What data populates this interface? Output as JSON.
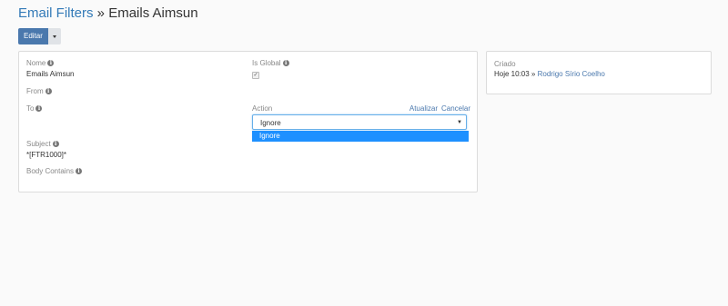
{
  "header": {
    "breadcrumb_link": "Email Filters",
    "separator": " » ",
    "current": "Emails Aimsun"
  },
  "toolbar": {
    "edit_label": "Editar"
  },
  "form": {
    "name": {
      "label": "Nome",
      "value": "Emails Aimsun"
    },
    "is_global": {
      "label": "Is Global",
      "checked": true
    },
    "from": {
      "label": "From"
    },
    "to": {
      "label": "To"
    },
    "action": {
      "label": "Action",
      "update_label": "Atualizar",
      "cancel_label": "Cancelar",
      "selected": "Ignore",
      "options": [
        "Ignore"
      ]
    },
    "subject": {
      "label": "Subject",
      "value": "*[FTR1000]*"
    },
    "body_contains": {
      "label": "Body Contains"
    }
  },
  "side": {
    "created_label": "Criado",
    "created_time": "Hoje 10:03",
    "created_separator": " » ",
    "created_by": "Rodrigo Sírio Coelho"
  },
  "colors": {
    "link": "#337ab7",
    "button": "#4a78ad",
    "dropdown_highlight": "#1e90ff"
  },
  "icons": {
    "info": "info-icon",
    "caret": "chevron-down-icon",
    "checkbox": "checkbox-icon"
  }
}
